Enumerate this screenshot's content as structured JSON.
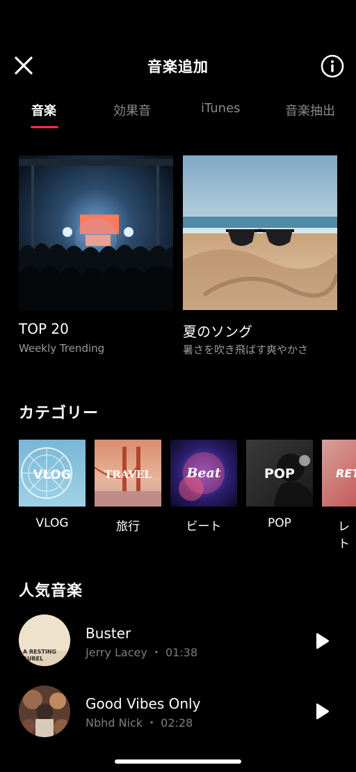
{
  "header": {
    "title": "音楽追加",
    "close_icon": "close-icon",
    "info_icon": "info-icon"
  },
  "tabs": [
    {
      "label": "音楽",
      "active": true
    },
    {
      "label": "効果音",
      "active": false
    },
    {
      "label": "iTunes",
      "active": false
    },
    {
      "label": "音楽抽出",
      "active": false
    }
  ],
  "featured": [
    {
      "title": "TOP 20",
      "subtitle": "Weekly Trending"
    },
    {
      "title": "夏のソング",
      "subtitle": "暑さを吹き飛ばす爽やかさ"
    }
  ],
  "categories": {
    "header": "カテゴリー",
    "items": [
      {
        "label": "VLOG",
        "tile_text": "VLOG"
      },
      {
        "label": "旅行",
        "tile_text": "TRAVEL"
      },
      {
        "label": "ビート",
        "tile_text": "Beat"
      },
      {
        "label": "POP",
        "tile_text": "POP"
      },
      {
        "label": "レト",
        "tile_text": "RET"
      }
    ]
  },
  "popular": {
    "header": "人気音楽",
    "tracks": [
      {
        "title": "Buster",
        "artist": "Jerry Lacey",
        "duration": "01:38",
        "art_text": "A RESTING\nLAUREL",
        "meta": "Jerry Lacey ・ 01:38"
      },
      {
        "title": "Good Vibes Only",
        "artist": "Nbhd Nick",
        "duration": "02:28",
        "meta": "Nbhd Nick ・ 02:28"
      }
    ]
  },
  "colors": {
    "accent": "#ff2d4b",
    "background": "#000000",
    "muted_text": "#9a9a9a"
  }
}
